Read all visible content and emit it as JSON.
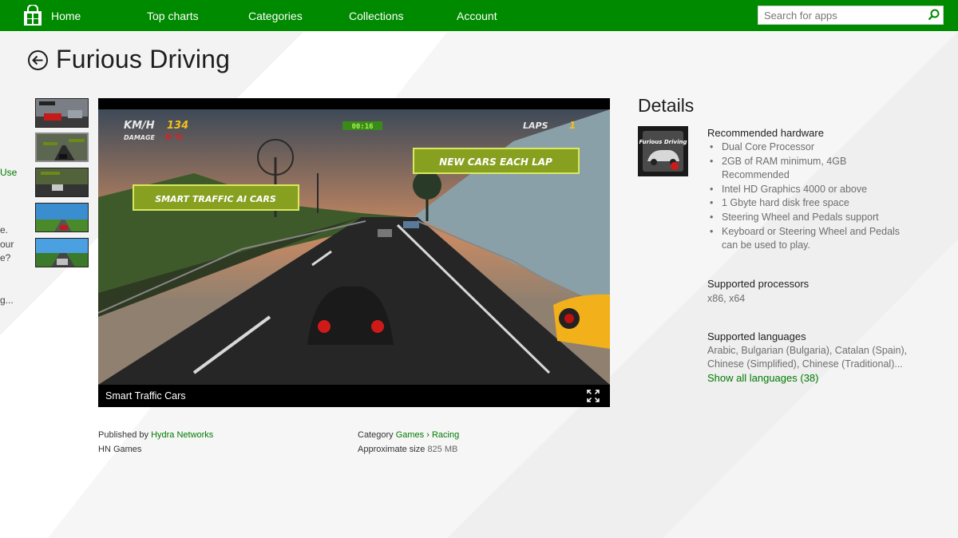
{
  "nav": {
    "items": [
      "Home",
      "Top charts",
      "Categories",
      "Collections",
      "Account"
    ],
    "search_placeholder": "Search for apps"
  },
  "page": {
    "title": "Furious Driving"
  },
  "left_clipped_text": [
    "Use",
    "e.",
    "our",
    "e?",
    "g..."
  ],
  "viewer": {
    "caption": "Smart Traffic Cars",
    "game_hud": {
      "speed_label": "KM/H",
      "speed_value": "134",
      "damage_label": "DAMAGE",
      "damage_value": "0 %",
      "timer": "00:16",
      "laps_label": "LAPS",
      "laps_value": "1",
      "banner_right": "NEW CARS EACH LAP",
      "banner_left": "SMART TRAFFIC AI CARS"
    }
  },
  "meta": {
    "published_by_label": "Published by",
    "publisher": "Hydra Networks",
    "developer": "HN Games",
    "category_label": "Category",
    "category": "Games",
    "category_sep": "›",
    "subcategory": "Racing",
    "size_label": "Approximate size",
    "size_value": "825 MB"
  },
  "details": {
    "title": "Details",
    "tile_text": "Furious Driving",
    "recommended_hardware": {
      "heading": "Recommended hardware",
      "items": [
        [
          "Dual Core Processor"
        ],
        [
          "2GB of RAM minimum, 4GB",
          "Recommended"
        ],
        [
          "Intel HD Graphics 4000 or above"
        ],
        [
          "1 Gbyte hard disk free space"
        ],
        [
          "Steering Wheel and Pedals support"
        ],
        [
          "Keyboard or Steering Wheel and Pedals",
          "can be used to play."
        ]
      ]
    },
    "processors": {
      "heading": "Supported processors",
      "value": "x86, x64"
    },
    "languages": {
      "heading": "Supported languages",
      "line1": "Arabic, Bulgarian (Bulgaria), Catalan (Spain),",
      "line2": "Chinese (Simplified), Chinese (Traditional)...",
      "show_all": "Show all languages (38)"
    }
  },
  "colors": {
    "accent": "#008a00",
    "link": "#007a00"
  }
}
